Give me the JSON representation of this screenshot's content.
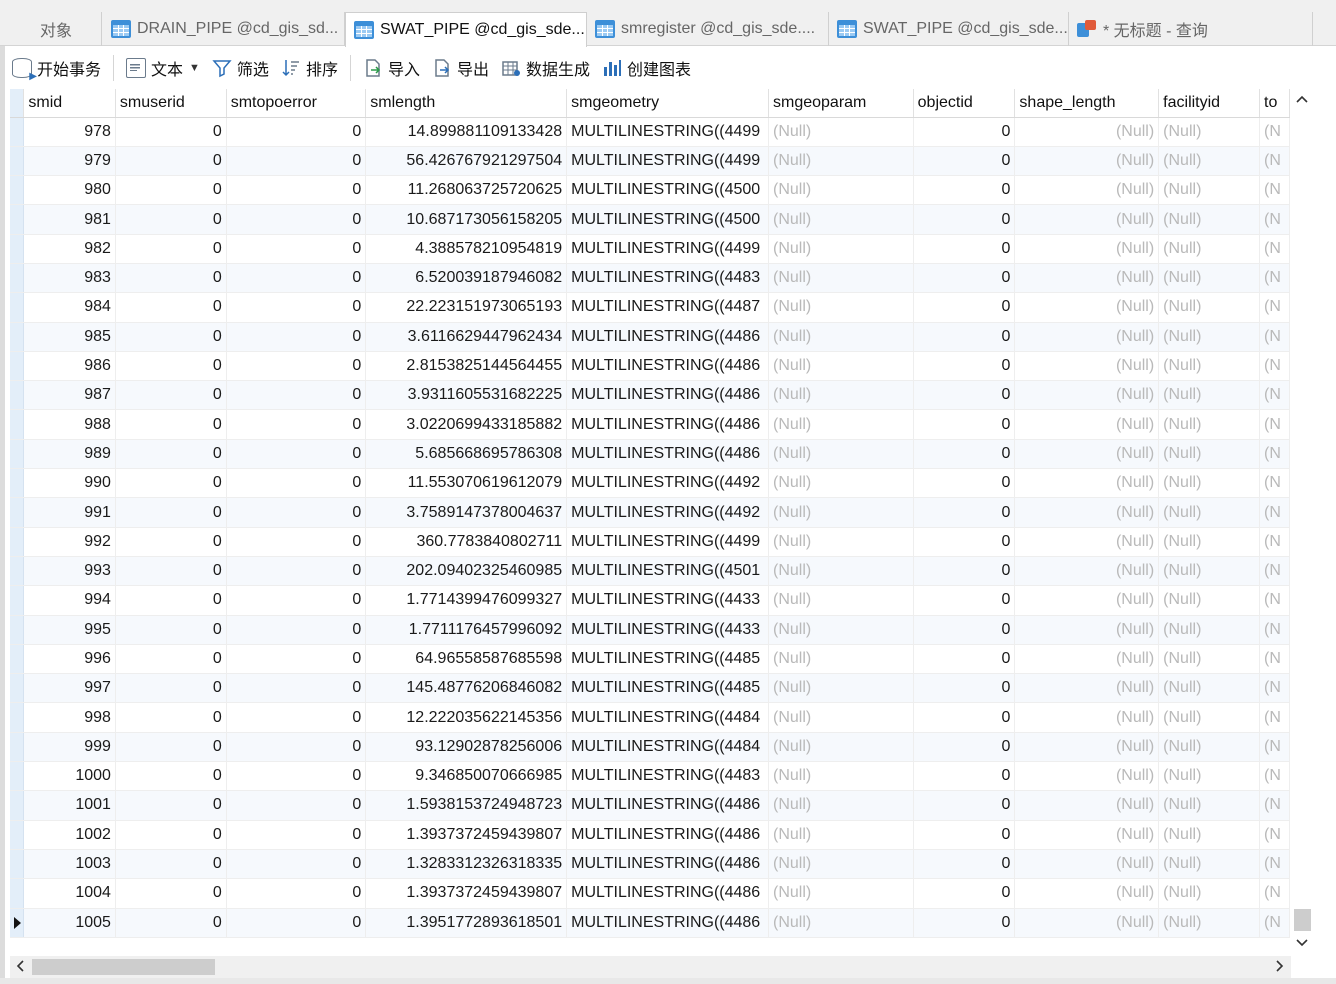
{
  "tabs": [
    {
      "label": "对象",
      "icon": "none",
      "active": false
    },
    {
      "label": "DRAIN_PIPE @cd_gis_sd...",
      "icon": "table-icon",
      "active": false
    },
    {
      "label": "SWAT_PIPE @cd_gis_sde...",
      "icon": "table-icon",
      "active": true
    },
    {
      "label": "smregister @cd_gis_sde....",
      "icon": "table-icon",
      "active": false
    },
    {
      "label": "SWAT_PIPE @cd_gis_sde...",
      "icon": "table-icon",
      "active": false
    },
    {
      "label": "* 无标题 - 查询",
      "icon": "query-icon",
      "active": false
    }
  ],
  "toolbar": {
    "begin_transaction": "开始事务",
    "text": "文本",
    "filter": "筛选",
    "sort": "排序",
    "import": "导入",
    "export": "导出",
    "generate_data": "数据生成",
    "create_chart": "创建图表"
  },
  "grid": {
    "columns": [
      "smid",
      "smuserid",
      "smtopoerror",
      "smlength",
      "smgeometry",
      "smgeoparam",
      "objectid",
      "shape_length",
      "facilityid",
      "to"
    ],
    "rows": [
      [
        "978",
        "0",
        "0",
        "14.899881109133428",
        "MULTILINESTRING((4499",
        "(Null)",
        "0",
        "(Null)",
        "(Null)",
        "(N"
      ],
      [
        "979",
        "0",
        "0",
        "56.426767921297504",
        "MULTILINESTRING((4499",
        "(Null)",
        "0",
        "(Null)",
        "(Null)",
        "(N"
      ],
      [
        "980",
        "0",
        "0",
        "11.268063725720625",
        "MULTILINESTRING((4500",
        "(Null)",
        "0",
        "(Null)",
        "(Null)",
        "(N"
      ],
      [
        "981",
        "0",
        "0",
        "10.687173056158205",
        "MULTILINESTRING((4500",
        "(Null)",
        "0",
        "(Null)",
        "(Null)",
        "(N"
      ],
      [
        "982",
        "0",
        "0",
        "4.388578210954819",
        "MULTILINESTRING((4499",
        "(Null)",
        "0",
        "(Null)",
        "(Null)",
        "(N"
      ],
      [
        "983",
        "0",
        "0",
        "6.520039187946082",
        "MULTILINESTRING((4483",
        "(Null)",
        "0",
        "(Null)",
        "(Null)",
        "(N"
      ],
      [
        "984",
        "0",
        "0",
        "22.223151973065193",
        "MULTILINESTRING((4487",
        "(Null)",
        "0",
        "(Null)",
        "(Null)",
        "(N"
      ],
      [
        "985",
        "0",
        "0",
        "3.6116629447962434",
        "MULTILINESTRING((4486",
        "(Null)",
        "0",
        "(Null)",
        "(Null)",
        "(N"
      ],
      [
        "986",
        "0",
        "0",
        "2.8153825144564455",
        "MULTILINESTRING((4486",
        "(Null)",
        "0",
        "(Null)",
        "(Null)",
        "(N"
      ],
      [
        "987",
        "0",
        "0",
        "3.9311605531682225",
        "MULTILINESTRING((4486",
        "(Null)",
        "0",
        "(Null)",
        "(Null)",
        "(N"
      ],
      [
        "988",
        "0",
        "0",
        "3.0220699433185882",
        "MULTILINESTRING((4486",
        "(Null)",
        "0",
        "(Null)",
        "(Null)",
        "(N"
      ],
      [
        "989",
        "0",
        "0",
        "5.685668695786308",
        "MULTILINESTRING((4486",
        "(Null)",
        "0",
        "(Null)",
        "(Null)",
        "(N"
      ],
      [
        "990",
        "0",
        "0",
        "11.553070619612079",
        "MULTILINESTRING((4492",
        "(Null)",
        "0",
        "(Null)",
        "(Null)",
        "(N"
      ],
      [
        "991",
        "0",
        "0",
        "3.7589147378004637",
        "MULTILINESTRING((4492",
        "(Null)",
        "0",
        "(Null)",
        "(Null)",
        "(N"
      ],
      [
        "992",
        "0",
        "0",
        "360.7783840802711",
        "MULTILINESTRING((4499",
        "(Null)",
        "0",
        "(Null)",
        "(Null)",
        "(N"
      ],
      [
        "993",
        "0",
        "0",
        "202.09402325460985",
        "MULTILINESTRING((4501",
        "(Null)",
        "0",
        "(Null)",
        "(Null)",
        "(N"
      ],
      [
        "994",
        "0",
        "0",
        "1.7714399476099327",
        "MULTILINESTRING((4433",
        "(Null)",
        "0",
        "(Null)",
        "(Null)",
        "(N"
      ],
      [
        "995",
        "0",
        "0",
        "1.7711176457996092",
        "MULTILINESTRING((4433",
        "(Null)",
        "0",
        "(Null)",
        "(Null)",
        "(N"
      ],
      [
        "996",
        "0",
        "0",
        "64.96558587685598",
        "MULTILINESTRING((4485",
        "(Null)",
        "0",
        "(Null)",
        "(Null)",
        "(N"
      ],
      [
        "997",
        "0",
        "0",
        "145.48776206846082",
        "MULTILINESTRING((4485",
        "(Null)",
        "0",
        "(Null)",
        "(Null)",
        "(N"
      ],
      [
        "998",
        "0",
        "0",
        "12.222035622145356",
        "MULTILINESTRING((4484",
        "(Null)",
        "0",
        "(Null)",
        "(Null)",
        "(N"
      ],
      [
        "999",
        "0",
        "0",
        "93.12902878256006",
        "MULTILINESTRING((4484",
        "(Null)",
        "0",
        "(Null)",
        "(Null)",
        "(N"
      ],
      [
        "1000",
        "0",
        "0",
        "9.346850070666985",
        "MULTILINESTRING((4483",
        "(Null)",
        "0",
        "(Null)",
        "(Null)",
        "(N"
      ],
      [
        "1001",
        "0",
        "0",
        "1.5938153724948723",
        "MULTILINESTRING((4486",
        "(Null)",
        "0",
        "(Null)",
        "(Null)",
        "(N"
      ],
      [
        "1002",
        "0",
        "0",
        "1.3937372459439807",
        "MULTILINESTRING((4486",
        "(Null)",
        "0",
        "(Null)",
        "(Null)",
        "(N"
      ],
      [
        "1003",
        "0",
        "0",
        "1.3283312326318335",
        "MULTILINESTRING((4486",
        "(Null)",
        "0",
        "(Null)",
        "(Null)",
        "(N"
      ],
      [
        "1004",
        "0",
        "0",
        "1.3937372459439807",
        "MULTILINESTRING((4486",
        "(Null)",
        "0",
        "(Null)",
        "(Null)",
        "(N"
      ],
      [
        "1005",
        "0",
        "0",
        "1.3951772893618501",
        "MULTILINESTRING((4486",
        "(Null)",
        "0",
        "(Null)",
        "(Null)",
        "(N"
      ]
    ]
  },
  "scroll": {
    "up_glyph": "^",
    "down_glyph": "v",
    "left_glyph": "<",
    "right_glyph": ">"
  },
  "colors": {
    "selected_row_header": "#e3eef9",
    "null_text": "#b9b9b9",
    "zebra": "#f6f9fd",
    "accent": "#3d8fd8"
  }
}
